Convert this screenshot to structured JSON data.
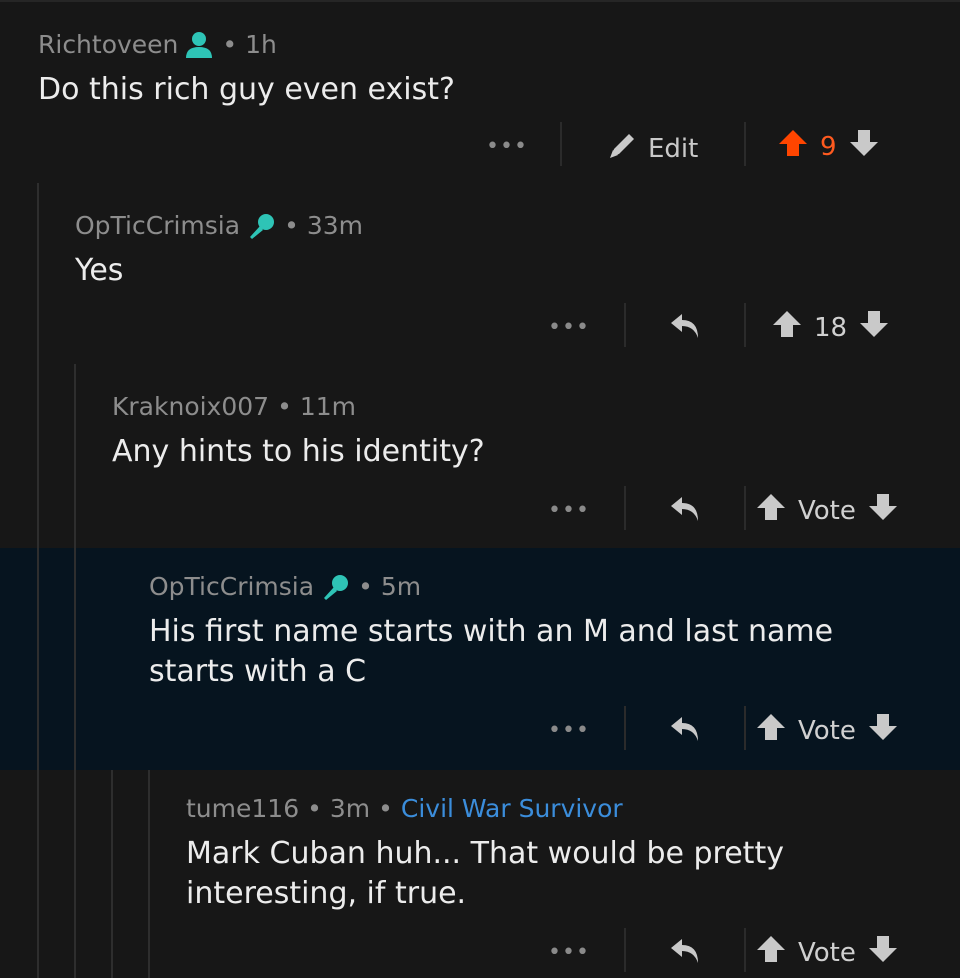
{
  "colors": {
    "background": "#171717",
    "highlight": "#06141f",
    "upvote_active": "#ff4500",
    "flair": "#3b8ddb",
    "mod_icon": "#2ec4b6"
  },
  "comments": [
    {
      "author": "Richtoveen",
      "author_icon": "op-person-icon",
      "time": "1h",
      "body": "Do this rich guy even exist?",
      "action": "Edit",
      "score": "9",
      "upvoted": true
    },
    {
      "author": "OpTicCrimsia",
      "author_icon": "microphone-icon",
      "time": "33m",
      "body": "Yes",
      "score": "18"
    },
    {
      "author": "Kraknoix007",
      "time": "11m",
      "body": "Any hints to his identity?",
      "score": "Vote"
    },
    {
      "author": "OpTicCrimsia",
      "author_icon": "microphone-icon",
      "time": "5m",
      "body": "His first name starts with an M and last name\nstarts with a C",
      "score": "Vote"
    },
    {
      "author": "tume116",
      "time": "3m",
      "flair": "Civil War Survivor",
      "body": "Mark Cuban huh... That would be pretty\ninteresting, if true.",
      "score": "Vote"
    }
  ],
  "ui": {
    "more_label": "•••",
    "dot": "•"
  }
}
